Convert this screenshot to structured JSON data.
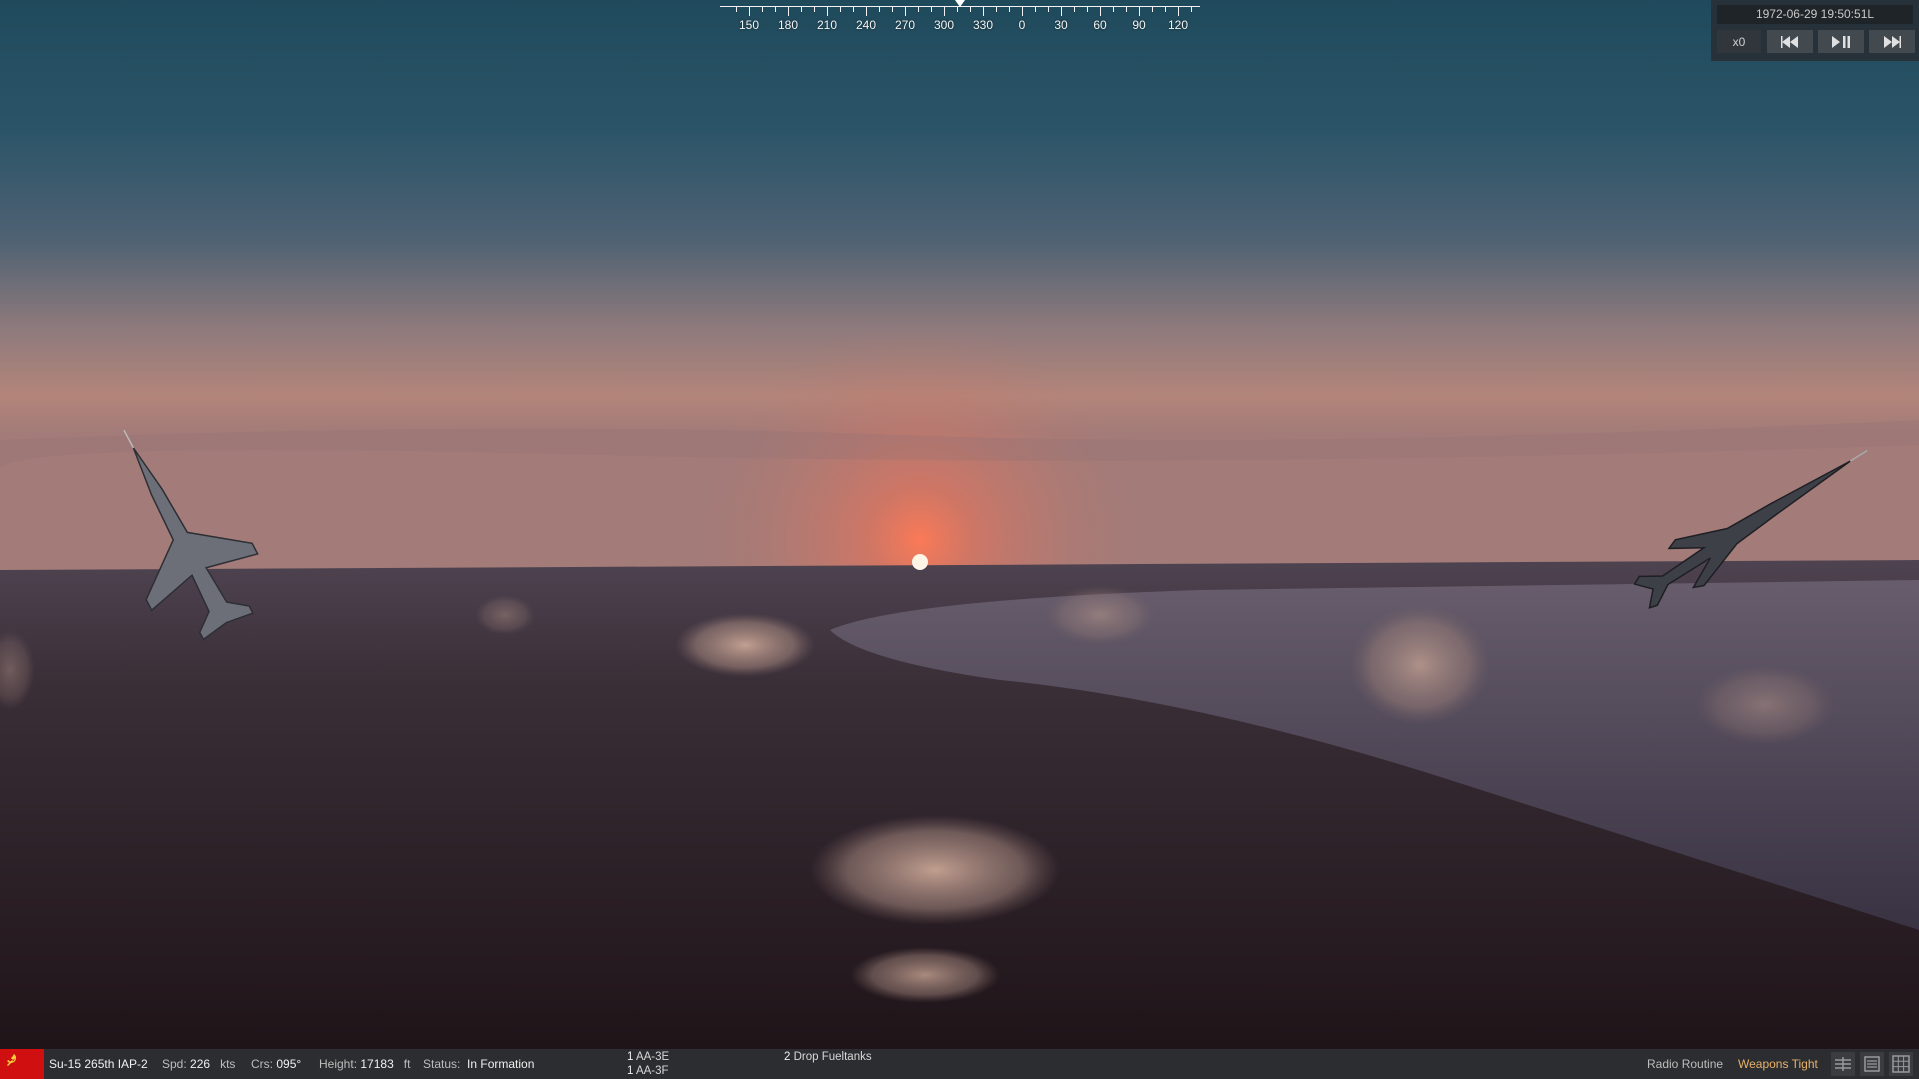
{
  "compass": {
    "labels": [
      "150",
      "180",
      "210",
      "240",
      "270",
      "300",
      "330",
      "0",
      "30",
      "60",
      "90",
      "120"
    ]
  },
  "time_panel": {
    "datetime": "1972-06-29 19:50:51L",
    "speed_multiplier": "x0",
    "buttons": {
      "rewind": "rewind-icon",
      "play_pause": "play-pause-icon",
      "fast_forward": "fast-forward-icon"
    }
  },
  "status_bar": {
    "faction_flag": "soviet-flag-icon",
    "unit": "Su-15 265th IAP-2",
    "speed": {
      "label": "Spd:",
      "value": "226",
      "unit": "kts"
    },
    "course": {
      "label": "Crs:",
      "value": "095°"
    },
    "height": {
      "label": "Height:",
      "value": "17183",
      "unit": "ft"
    },
    "status": {
      "label": "Status:",
      "value": "In Formation"
    },
    "loadout": [
      {
        "count": "1",
        "name": "AA-3E"
      },
      {
        "count": "1",
        "name": "AA-3F"
      }
    ],
    "stores": {
      "count": "2",
      "name": "Drop Fueltanks"
    },
    "radio": "Radio Routine",
    "weapons": "Weapons Tight",
    "colors": {
      "weapons_tight": "#e8b26a",
      "flag": "#d01010"
    }
  }
}
